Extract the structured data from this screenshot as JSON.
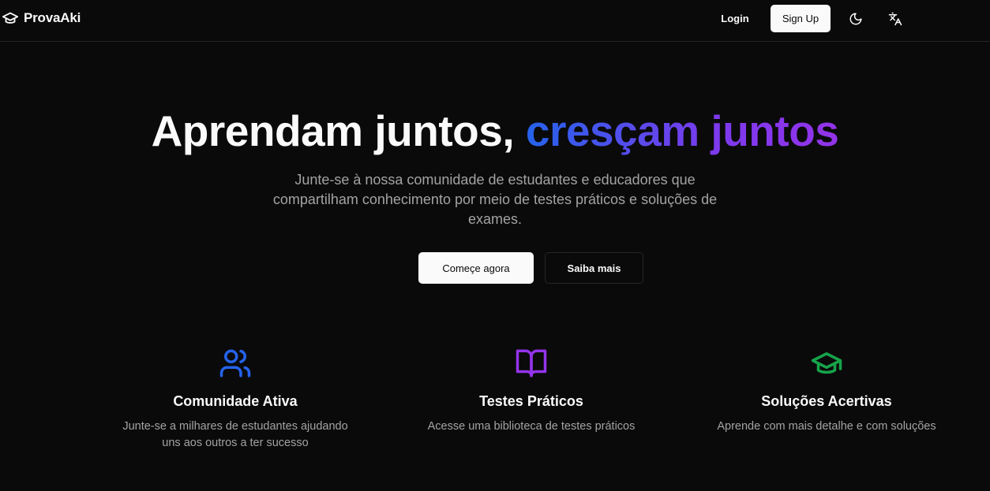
{
  "header": {
    "brand": "ProvaAki",
    "login_label": "Login",
    "signup_label": "Sign Up"
  },
  "hero": {
    "title_plain": "Aprendam juntos, ",
    "title_highlight": "cresçam juntos",
    "subtitle_lines": [
      "Junte-se à nossa comunidade de estudantes e educadores que",
      "compartilham conhecimento por meio de testes práticos e soluções de",
      "exames."
    ],
    "primary_cta": "Começe agora",
    "secondary_cta": "Saiba mais"
  },
  "features": [
    {
      "icon": "users-icon",
      "color": "#2563eb",
      "title": "Comunidade Ativa",
      "desc_lines": [
        "Junte-se a milhares de estudantes ajudando",
        "uns aos outros a ter sucesso"
      ]
    },
    {
      "icon": "book-open-icon",
      "color": "#9333ea",
      "title": "Testes Práticos",
      "desc_lines": [
        "Acesse uma biblioteca de testes práticos"
      ]
    },
    {
      "icon": "graduation-cap-icon",
      "color": "#16a34a",
      "title": "Soluções Acertivas",
      "desc_lines": [
        "Aprende com mais detalhe e com soluções"
      ]
    }
  ],
  "colors": {
    "background": "#0a0a0a",
    "gradient_start": "#2563eb",
    "gradient_end": "#9333ea",
    "muted_text": "#a3a3a3"
  }
}
